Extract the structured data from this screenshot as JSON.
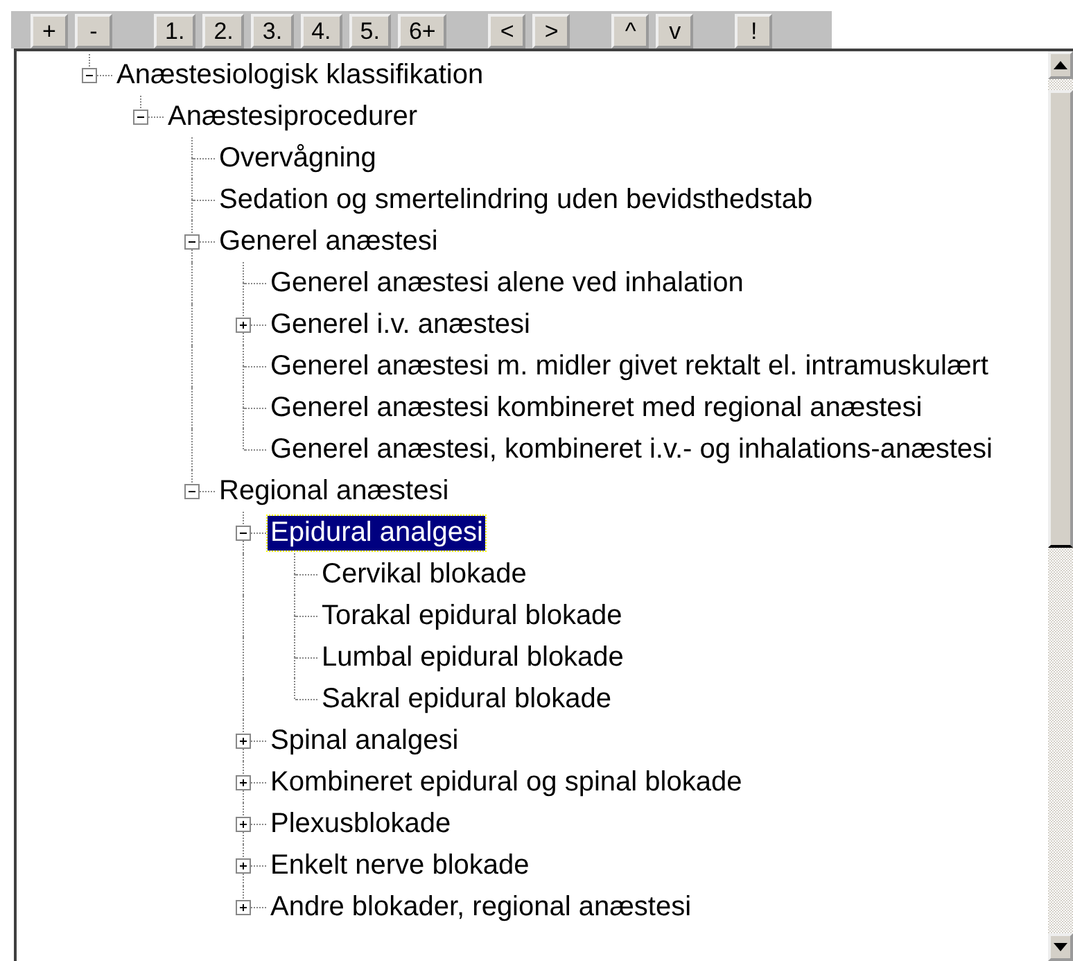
{
  "toolbar": {
    "groups": [
      [
        "+",
        "-"
      ],
      [
        "1.",
        "2.",
        "3.",
        "4.",
        "5.",
        "6+"
      ],
      [
        "<",
        ">"
      ],
      [
        "^",
        "v"
      ],
      [
        "!"
      ]
    ]
  },
  "tree": {
    "nodes": [
      {
        "label": "Anæstesiologisk klassifikation",
        "kind": "branch",
        "expanded": true,
        "selected": false,
        "children": [
          {
            "label": "Anæstesiprocedurer",
            "kind": "branch",
            "expanded": true,
            "selected": false,
            "children": [
              {
                "label": "Overvågning",
                "kind": "leaf",
                "selected": false
              },
              {
                "label": "Sedation og smertelindring uden bevidsthedstab",
                "kind": "leaf",
                "selected": false
              },
              {
                "label": "Generel anæstesi",
                "kind": "branch",
                "expanded": true,
                "selected": false,
                "children": [
                  {
                    "label": "Generel anæstesi alene ved inhalation",
                    "kind": "leaf",
                    "selected": false
                  },
                  {
                    "label": "Generel i.v. anæstesi",
                    "kind": "branch",
                    "expanded": false,
                    "selected": false
                  },
                  {
                    "label": "Generel anæstesi m. midler givet rektalt el. intramuskulært",
                    "kind": "leaf",
                    "selected": false
                  },
                  {
                    "label": "Generel anæstesi kombineret med regional anæstesi",
                    "kind": "leaf",
                    "selected": false
                  },
                  {
                    "label": "Generel anæstesi, kombineret i.v.- og inhalations-anæstesi",
                    "kind": "leaf",
                    "selected": false
                  }
                ]
              },
              {
                "label": "Regional anæstesi",
                "kind": "branch",
                "expanded": true,
                "selected": false,
                "children": [
                  {
                    "label": "Epidural analgesi",
                    "kind": "branch",
                    "expanded": true,
                    "selected": true,
                    "children": [
                      {
                        "label": "Cervikal blokade",
                        "kind": "leaf",
                        "selected": false
                      },
                      {
                        "label": "Torakal epidural blokade",
                        "kind": "leaf",
                        "selected": false
                      },
                      {
                        "label": "Lumbal epidural blokade",
                        "kind": "leaf",
                        "selected": false
                      },
                      {
                        "label": "Sakral epidural blokade",
                        "kind": "leaf",
                        "selected": false
                      }
                    ]
                  },
                  {
                    "label": "Spinal analgesi",
                    "kind": "branch",
                    "expanded": false,
                    "selected": false
                  },
                  {
                    "label": "Kombineret epidural og spinal blokade",
                    "kind": "branch",
                    "expanded": false,
                    "selected": false
                  },
                  {
                    "label": "Plexusblokade",
                    "kind": "branch",
                    "expanded": false,
                    "selected": false
                  },
                  {
                    "label": "Enkelt nerve blokade",
                    "kind": "branch",
                    "expanded": false,
                    "selected": false
                  },
                  {
                    "label": "Andre blokader, regional anæstesi",
                    "kind": "branch",
                    "expanded": false,
                    "selected": false
                  }
                ]
              }
            ]
          }
        ]
      }
    ]
  }
}
